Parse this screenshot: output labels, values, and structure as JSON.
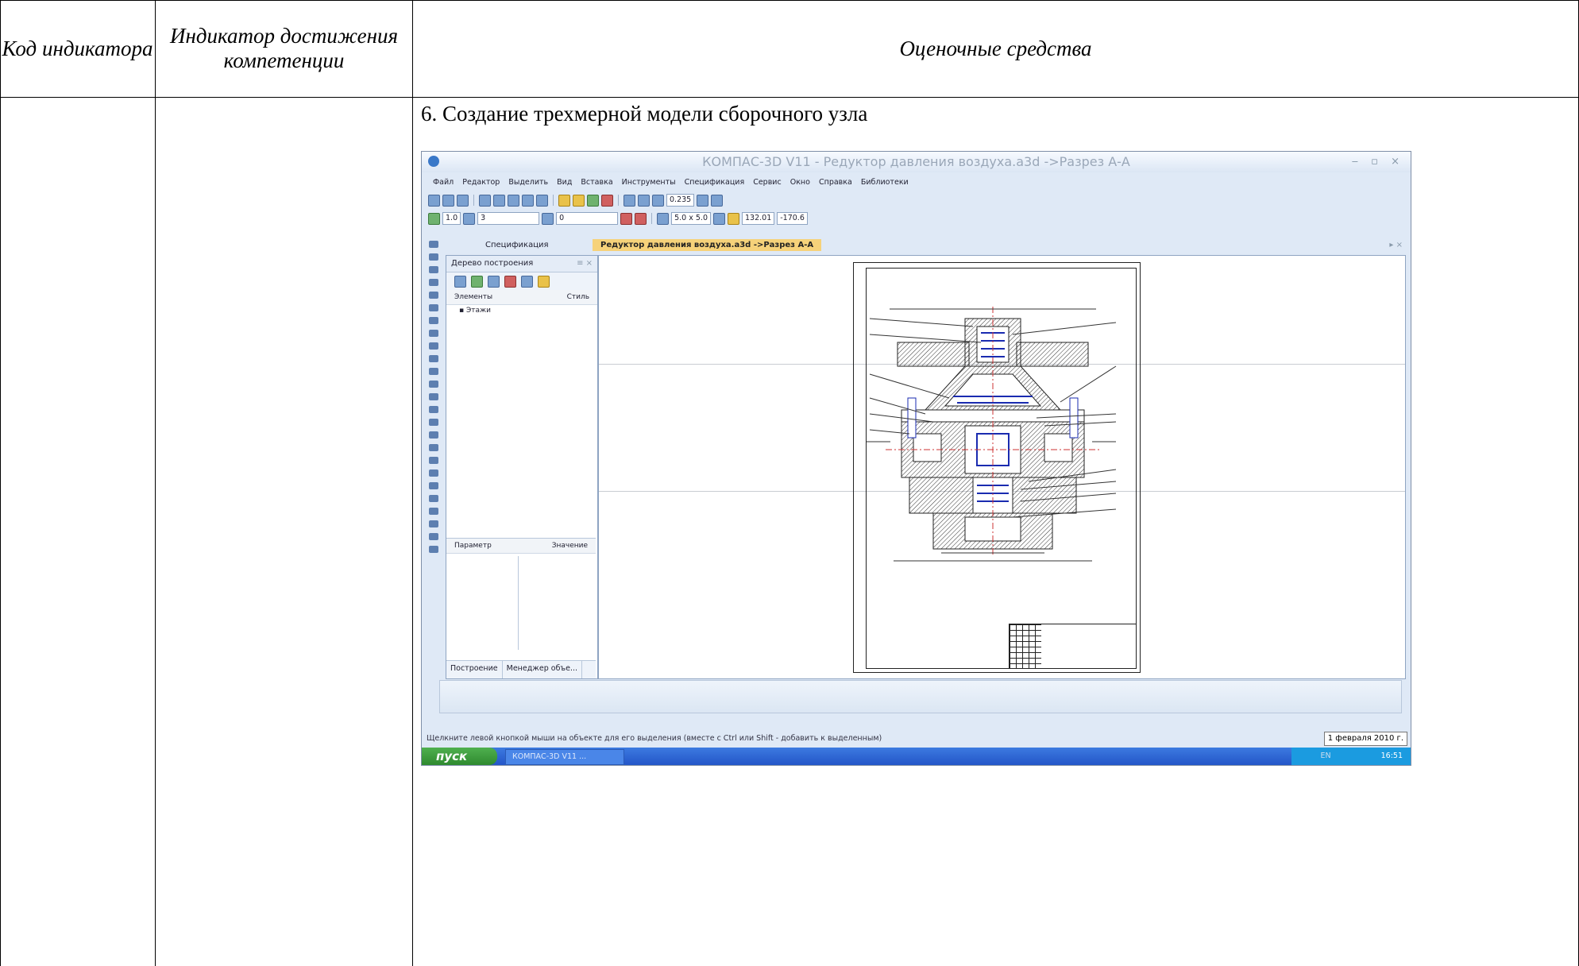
{
  "table": {
    "headers": [
      "Код индикатора",
      "Индикатор достижения компетенции",
      "Оценочные средства"
    ],
    "task_text": "6. Создание трехмерной модели сборочного узла"
  },
  "screenshot": {
    "title": "КОМПАС-3D V11 - Редуктор давления воздуха.a3d ->Разрез А-А",
    "menu": [
      "Файл",
      "Редактор",
      "Выделить",
      "Вид",
      "Вставка",
      "Инструменты",
      "Спецификация",
      "Сервис",
      "Окно",
      "Справка",
      "Библиотеки"
    ],
    "toolbar": {
      "zoom": "0.235",
      "line_width": "1.0",
      "layer": "3",
      "style": "0",
      "grid": "5.0 x 5.0",
      "coord_x": "132.01",
      "coord_y": "-170.6"
    },
    "tabs": [
      "Спецификация",
      "Редуктор давления воздуха.a3d ->Разрез А-А"
    ],
    "tree": {
      "title": "Дерево построения",
      "col_elements": "Элементы",
      "col_style": "Стиль",
      "item": "Этажи",
      "param_col": "Параметр",
      "value_col": "Значение",
      "tab_build": "Построение",
      "tab_manager": "Менеджер объе..."
    },
    "status_text": "Щелкните левой кнопкой мыши на объекте для его выделения (вместе с Ctrl или Shift - добавить к выделенным)",
    "date": "1 февраля 2010 г.",
    "start_label": "пуск",
    "task_item": "КОМПАС-3D V11 ...",
    "lang": "EN",
    "clock": "16:51"
  }
}
